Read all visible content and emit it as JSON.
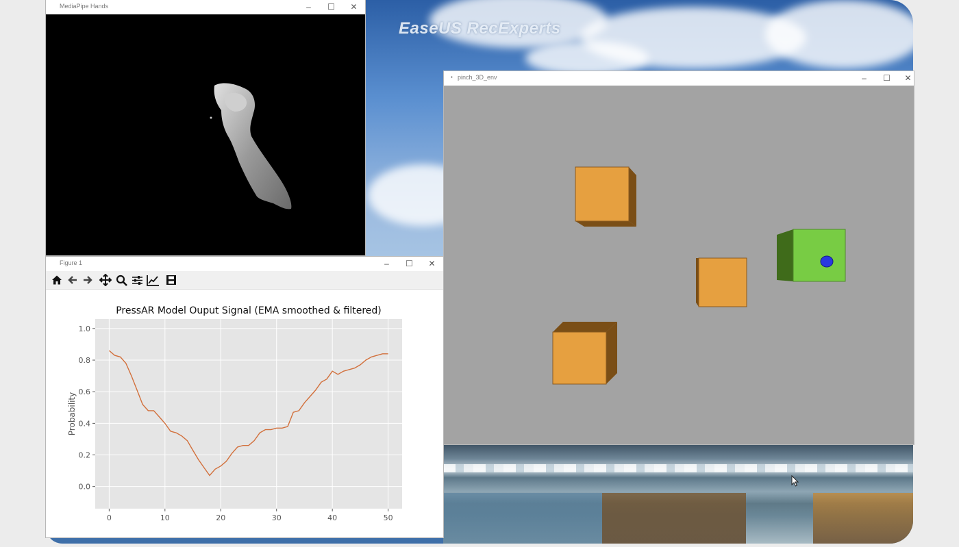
{
  "watermark": "EaseUS RecExperts",
  "windows": {
    "mediapipe": {
      "title": "MediaPipe Hands",
      "minimize": "–",
      "maximize": "☐",
      "close": "✕"
    },
    "figure": {
      "title": "Figure 1",
      "minimize": "–",
      "maximize": "☐",
      "close": "✕"
    },
    "pinch": {
      "title": "pinch_3D_env",
      "minimize": "–",
      "maximize": "☐",
      "close": "✕"
    }
  },
  "toolbar_icons": [
    "home-icon",
    "back-arrow-icon",
    "forward-arrow-icon",
    "pan-move-icon",
    "zoom-icon",
    "configure-subplots-icon",
    "edit-axis-icon",
    "save-icon"
  ],
  "colors": {
    "box_orange": "#e6a040",
    "box_green": "#78cc44",
    "sphere_blue": "#2a38e0",
    "line": "#d2703c",
    "plot_bg": "#e5e5e5"
  },
  "chart_data": {
    "type": "line",
    "title": "PressAR Model Ouput Signal (EMA smoothed & filtered)",
    "xlabel": "",
    "ylabel": "Probability",
    "xlim": [
      -2.5,
      52.5
    ],
    "ylim": [
      -0.14,
      1.06
    ],
    "xticks": [
      0,
      10,
      20,
      30,
      40,
      50
    ],
    "yticks": [
      0.0,
      0.2,
      0.4,
      0.6,
      0.8,
      1.0
    ],
    "grid": true,
    "series": [
      {
        "x": [
          0,
          1,
          2,
          3,
          4,
          5,
          6,
          7,
          8,
          9,
          10,
          11,
          12,
          13,
          14,
          15,
          16,
          17,
          18,
          19,
          20,
          21,
          22,
          23,
          24,
          25,
          26,
          27,
          28,
          29,
          30,
          31,
          32,
          33,
          34,
          35,
          36,
          37,
          38,
          39,
          40,
          41,
          42,
          43,
          44,
          45,
          46,
          47,
          48,
          49,
          50
        ],
        "values": [
          0.86,
          0.83,
          0.82,
          0.78,
          0.7,
          0.61,
          0.52,
          0.48,
          0.48,
          0.44,
          0.4,
          0.35,
          0.34,
          0.32,
          0.29,
          0.23,
          0.17,
          0.12,
          0.07,
          0.11,
          0.13,
          0.16,
          0.21,
          0.25,
          0.26,
          0.26,
          0.29,
          0.34,
          0.36,
          0.36,
          0.37,
          0.37,
          0.38,
          0.47,
          0.48,
          0.53,
          0.57,
          0.61,
          0.66,
          0.68,
          0.73,
          0.71,
          0.73,
          0.74,
          0.75,
          0.77,
          0.8,
          0.82,
          0.83,
          0.84,
          0.84
        ]
      }
    ]
  }
}
